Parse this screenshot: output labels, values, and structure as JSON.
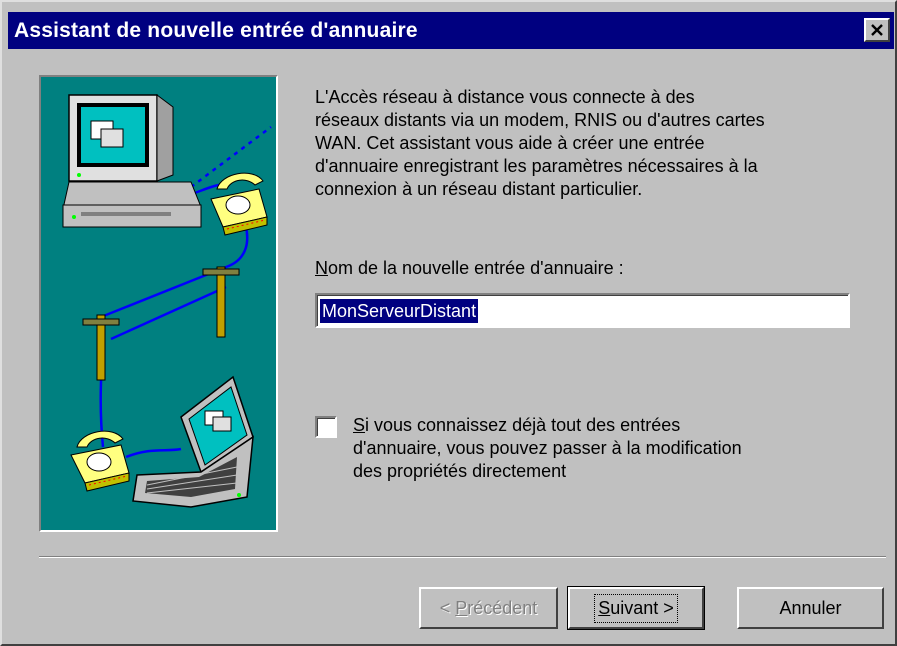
{
  "window": {
    "title": "Assistant de nouvelle entrée d'annuaire",
    "close_symbol": "×"
  },
  "description": [
    "L'Accès réseau à distance vous connecte à des",
    "réseaux distants via un modem, RNIS ou d'autres cartes",
    "WAN. Cet assistant vous aide à créer une entrée",
    "d'annuaire enregistrant les paramètres nécessaires à la",
    "connexion à un réseau distant particulier."
  ],
  "name_field": {
    "label_accel": "N",
    "label_rest": "om de la nouvelle entrée d'annuaire :",
    "value": "MonServeurDistant"
  },
  "skip_option": {
    "checked": false,
    "accel": "S",
    "line1_rest": "i vous connaissez déjà tout des entrées",
    "line2": "d'annuaire, vous pouvez passer à la modification",
    "line3": "des propriétés directement"
  },
  "buttons": {
    "back_prefix": "< ",
    "back_accel": "P",
    "back_rest": "récédent",
    "next_accel": "S",
    "next_rest": "uivant >",
    "cancel": "Annuler"
  },
  "illustration": {
    "icons": [
      "desktop-computer-icon",
      "telephone-icon",
      "telephone-pole-icon",
      "laptop-icon"
    ],
    "colors": {
      "background": "#008080",
      "cable": "#0000ff",
      "phone": "#ffff80"
    }
  }
}
